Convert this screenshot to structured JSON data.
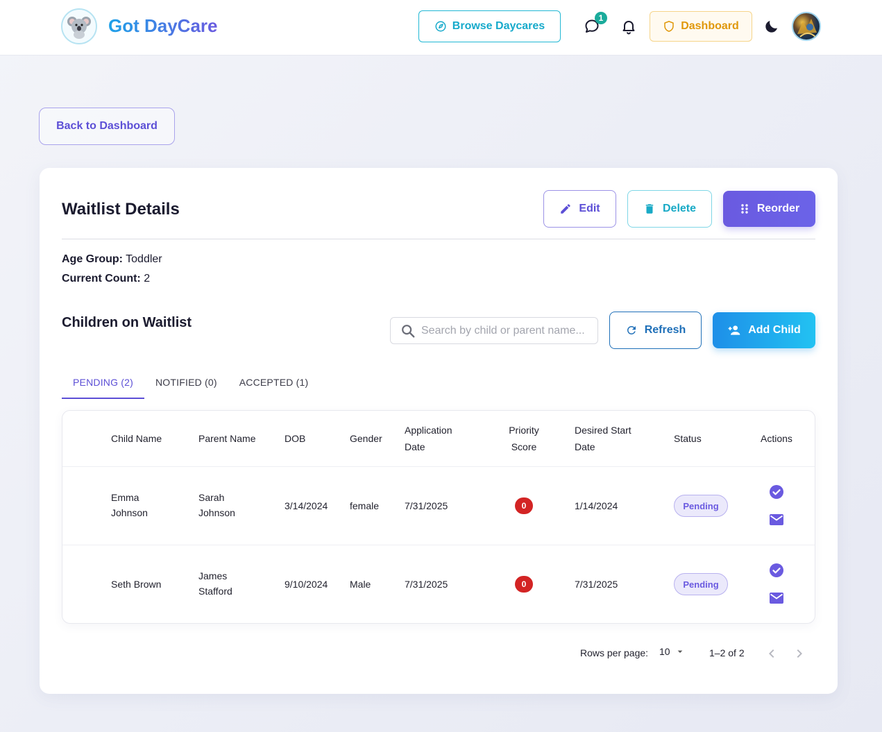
{
  "header": {
    "brand": "Got DayCare",
    "browse_label": "Browse Daycares",
    "chat_badge_count": "1",
    "dashboard_label": "Dashboard"
  },
  "back_label": "Back to Dashboard",
  "details": {
    "title": "Waitlist Details",
    "edit_label": "Edit",
    "delete_label": "Delete",
    "reorder_label": "Reorder",
    "age_group_label": "Age Group:",
    "age_group_value": "Toddler",
    "current_count_label": "Current Count:",
    "current_count_value": "2"
  },
  "children": {
    "title": "Children on Waitlist",
    "search_placeholder": "Search by child or parent name...",
    "refresh_label": "Refresh",
    "add_label": "Add Child"
  },
  "tabs": [
    {
      "label": "PENDING (2)",
      "active": true
    },
    {
      "label": "NOTIFIED (0)",
      "active": false
    },
    {
      "label": "ACCEPTED (1)",
      "active": false
    }
  ],
  "table": {
    "headers": {
      "child_name": "Child Name",
      "parent_name": "Parent Name",
      "dob": "DOB",
      "gender": "Gender",
      "app_date_1": "Application",
      "app_date_2": "Date",
      "priority_1": "Priority",
      "priority_2": "Score",
      "start_1": "Desired Start",
      "start_2": "Date",
      "status": "Status",
      "actions": "Actions"
    },
    "rows": [
      {
        "child_line1": "Emma",
        "child_line2": "Johnson",
        "parent_line1": "Sarah",
        "parent_line2": "Johnson",
        "dob": "3/14/2024",
        "gender": "female",
        "app_date": "7/31/2025",
        "priority": "0",
        "start_date": "1/14/2024",
        "status": "Pending"
      },
      {
        "child_line1": "Seth Brown",
        "child_line2": "",
        "parent_line1": "James",
        "parent_line2": "Stafford",
        "dob": "9/10/2024",
        "gender": "Male",
        "app_date": "7/31/2025",
        "priority": "0",
        "start_date": "7/31/2025",
        "status": "Pending"
      }
    ]
  },
  "pagination": {
    "rows_per_page_label": "Rows per page:",
    "rows_per_page_value": "10",
    "range": "1–2 of 2"
  },
  "colors": {
    "primary": "#6a5ae0",
    "accent_cyan": "#19aac6",
    "warning": "#e0980b",
    "priority_red": "#d32424"
  }
}
